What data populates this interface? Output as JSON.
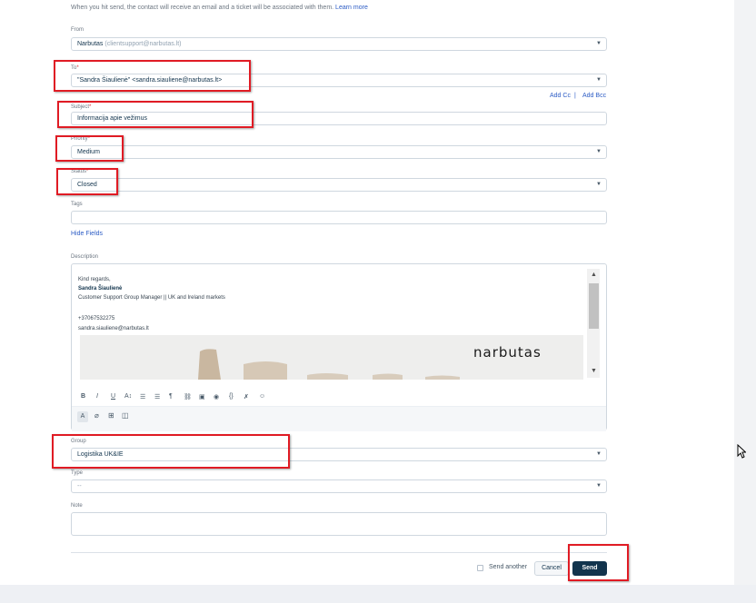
{
  "info": {
    "text": "When you hit send, the contact will receive an email and a ticket will be associated with them.",
    "link": "Learn more"
  },
  "from": {
    "label": "From",
    "name": "Narbutas",
    "email": "(clientsupport@narbutas.lt)"
  },
  "to": {
    "label": "To",
    "value": "\"Sandra Šiaulienė\" <sandra.siauliene@narbutas.lt>"
  },
  "cc_links": {
    "add_cc": "Add Cc",
    "separator": "|",
    "add_bcc": "Add Bcc"
  },
  "subject": {
    "label": "Subject",
    "value": "Informacija apie vežimus"
  },
  "priority": {
    "label": "Priority",
    "value": "Medium"
  },
  "status": {
    "label": "Status",
    "value": "Closed"
  },
  "tags": {
    "label": "Tags",
    "value": ""
  },
  "hide_fields": "Hide Fields",
  "description": {
    "label": "Description",
    "lines": [
      "Kind regards,",
      "Sandra Šiaulienė",
      "Customer Support Group Manager || UK and Ireland markets",
      "+37067532275",
      "sandra.siauliene@narbutas.lt"
    ],
    "banner_logo": "narbutas"
  },
  "group": {
    "label": "Group",
    "value": "Logistika UK&IE"
  },
  "type": {
    "label": "Type",
    "value": "--"
  },
  "note": {
    "label": "Note",
    "value": ""
  },
  "required_mark": "*",
  "footer": {
    "send_another": "Send another",
    "cancel": "Cancel",
    "send": "Send"
  },
  "colors": {
    "accent": "#2c5cc5",
    "send_button": "#12344d",
    "highlight": "#e01b24"
  }
}
